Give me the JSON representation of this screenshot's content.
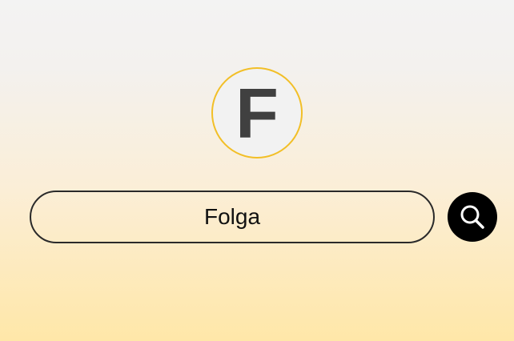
{
  "logo": {
    "letter": "F",
    "ring_color": "#f2bf27",
    "letter_color": "#404040"
  },
  "search": {
    "value": "Folga",
    "button_icon": "search-icon",
    "button_color": "#000000"
  }
}
